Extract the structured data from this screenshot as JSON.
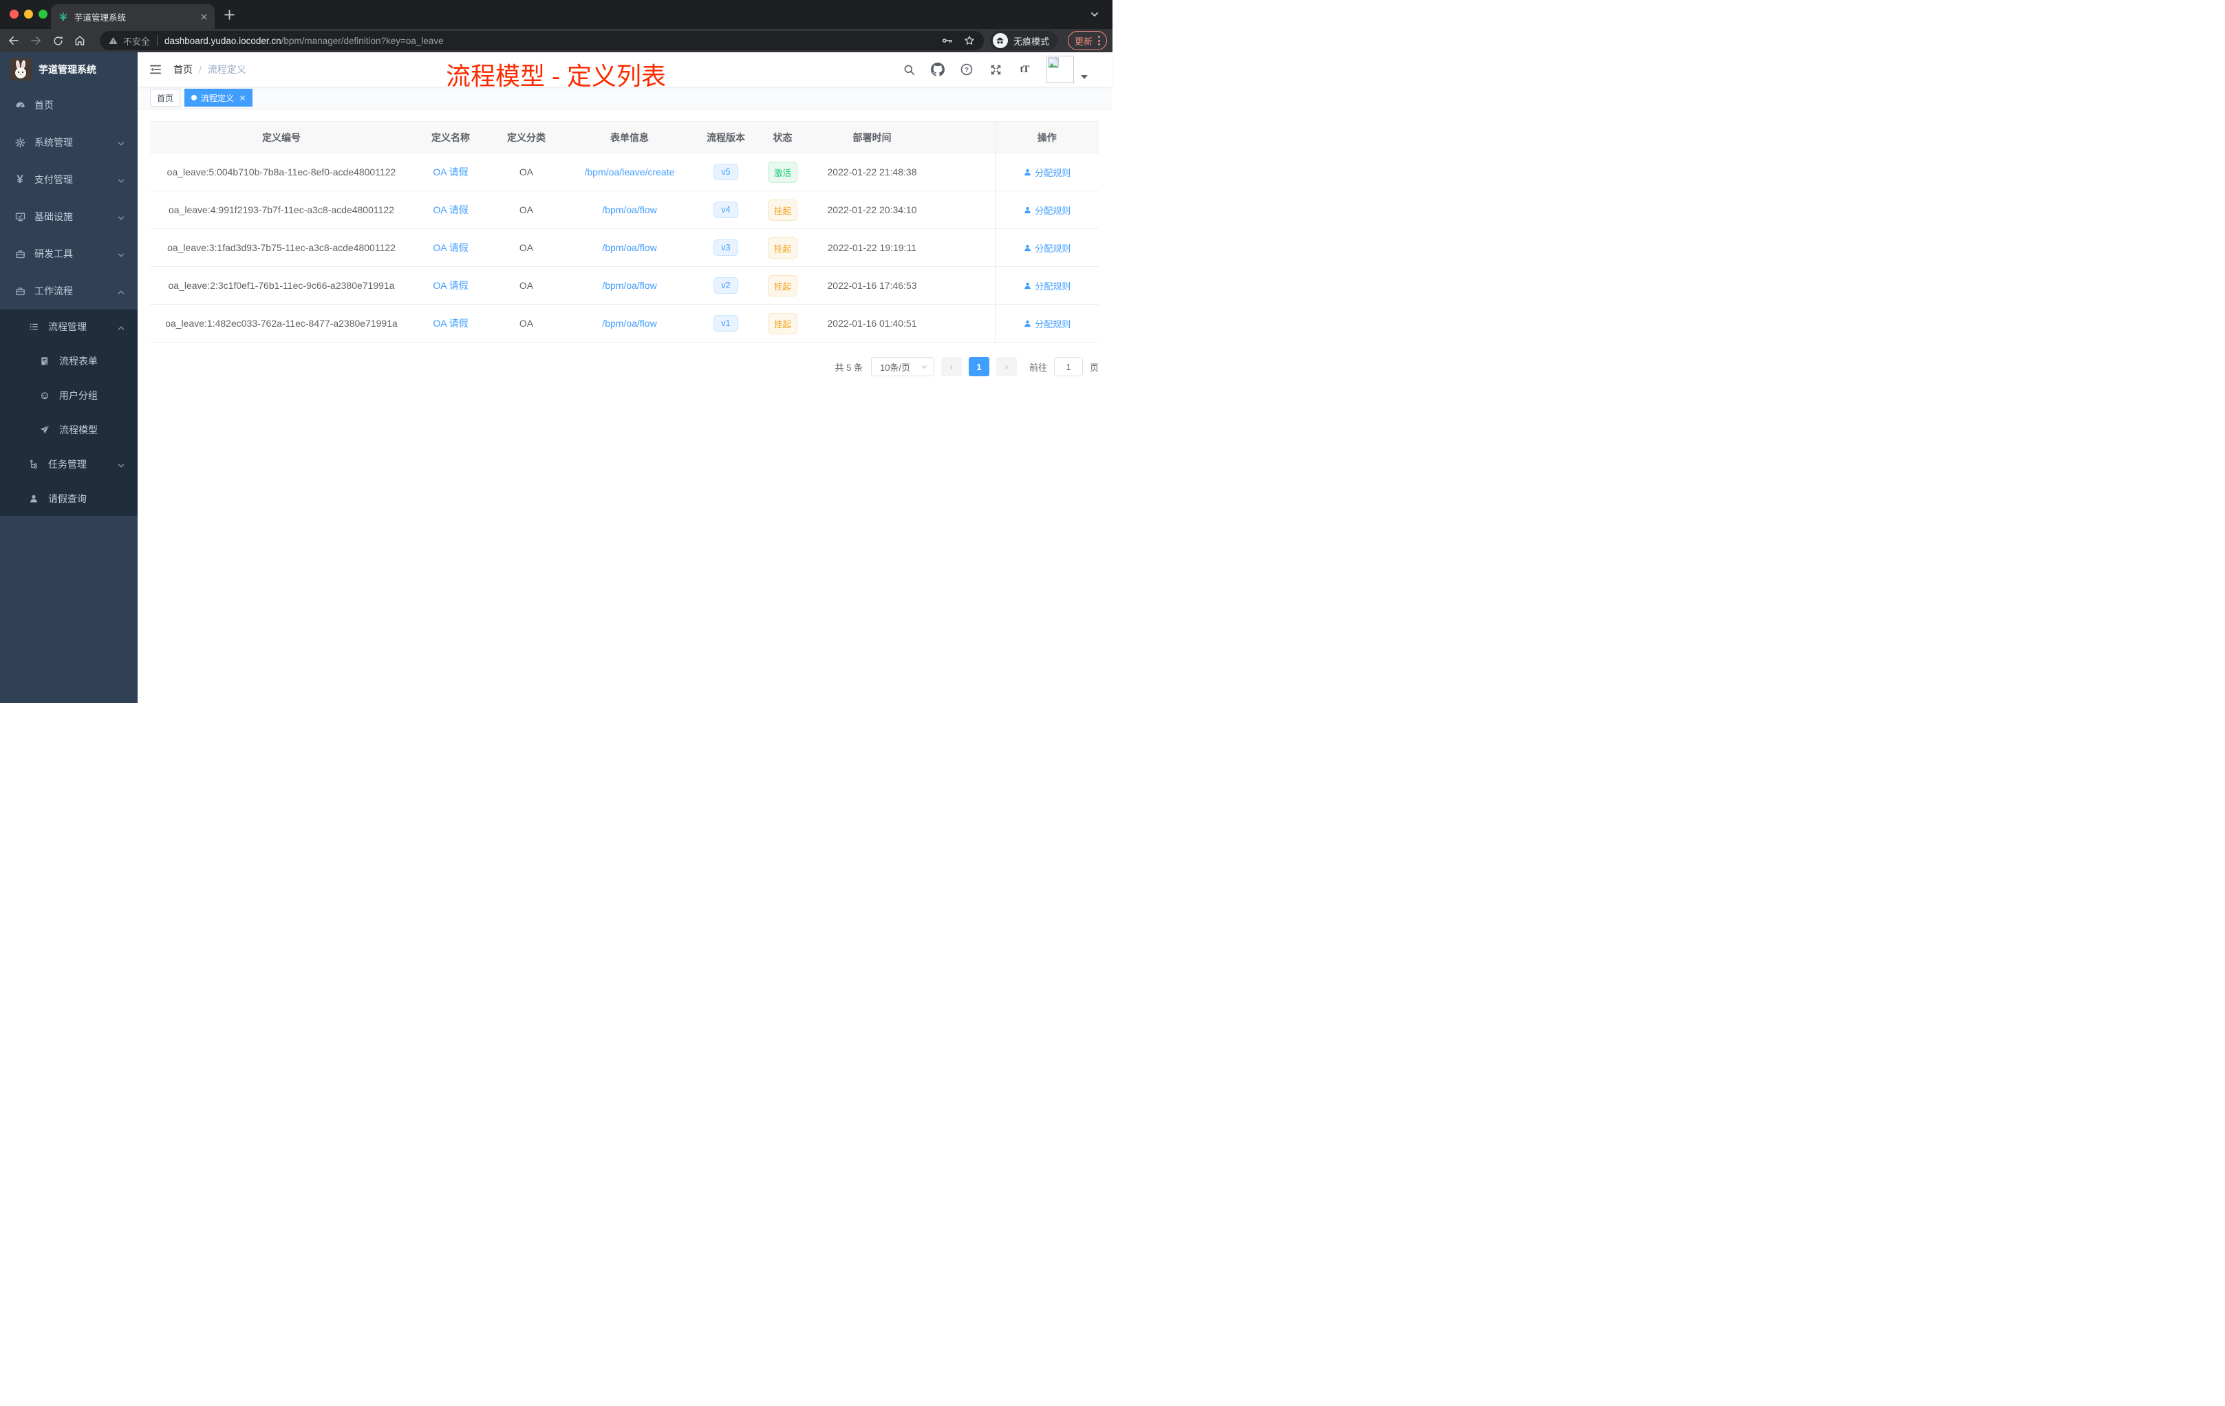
{
  "browser": {
    "tab": {
      "title": "芋道管理系统"
    },
    "url": {
      "security_text": "不安全",
      "host": "dashboard.yudao.iocoder.cn",
      "path": "/bpm/manager/definition?key=oa_leave"
    },
    "incognito_label": "无痕模式",
    "update_label": "更新"
  },
  "sidebar": {
    "title": "芋道管理系统",
    "items": [
      {
        "label": "首页",
        "icon": "dashboard-icon",
        "level": 1
      },
      {
        "label": "系统管理",
        "icon": "gear-icon",
        "level": 1,
        "state": "collapsed"
      },
      {
        "label": "支付管理",
        "icon": "yen-icon",
        "level": 1,
        "state": "collapsed"
      },
      {
        "label": "基础设施",
        "icon": "monitor-icon",
        "level": 1,
        "state": "collapsed"
      },
      {
        "label": "研发工具",
        "icon": "toolbox-icon",
        "level": 1,
        "state": "collapsed"
      },
      {
        "label": "工作流程",
        "icon": "briefcase-icon",
        "level": 1,
        "state": "expanded"
      },
      {
        "label": "流程管理",
        "icon": "list-icon",
        "level": 2,
        "state": "expanded"
      },
      {
        "label": "流程表单",
        "icon": "form-icon",
        "level": 3
      },
      {
        "label": "用户分组",
        "icon": "robot-icon",
        "level": 3
      },
      {
        "label": "流程模型",
        "icon": "paper-plane-icon",
        "level": 3
      },
      {
        "label": "任务管理",
        "icon": "branch-icon",
        "level": 2,
        "state": "collapsed"
      },
      {
        "label": "请假查询",
        "icon": "user-icon",
        "level": 2
      }
    ],
    "yen_glyph": "¥"
  },
  "navbar": {
    "breadcrumb": {
      "home": "首页",
      "separator": "/",
      "current": "流程定义"
    },
    "question_glyph": "?",
    "font_size_glyph": "tT"
  },
  "annotation": {
    "text": "流程模型 - 定义列表",
    "color": "#fb2b00"
  },
  "tags": {
    "home": "首页",
    "active": "流程定义"
  },
  "table": {
    "columns": [
      "定义编号",
      "定义名称",
      "定义分类",
      "表单信息",
      "流程版本",
      "状态",
      "部署时间",
      "操作"
    ],
    "action_label": "分配规则",
    "rows": [
      {
        "id": "oa_leave:5:004b710b-7b8a-11ec-8ef0-acde48001122",
        "name": "OA 请假",
        "category": "OA",
        "form": "/bpm/oa/leave/create",
        "version": "v5",
        "status": "激活",
        "status_type": "success",
        "time": "2022-01-22 21:48:38"
      },
      {
        "id": "oa_leave:4:991f2193-7b7f-11ec-a3c8-acde48001122",
        "name": "OA 请假",
        "category": "OA",
        "form": "/bpm/oa/flow",
        "version": "v4",
        "status": "挂起",
        "status_type": "warning",
        "time": "2022-01-22 20:34:10"
      },
      {
        "id": "oa_leave:3:1fad3d93-7b75-11ec-a3c8-acde48001122",
        "name": "OA 请假",
        "category": "OA",
        "form": "/bpm/oa/flow",
        "version": "v3",
        "status": "挂起",
        "status_type": "warning",
        "time": "2022-01-22 19:19:11"
      },
      {
        "id": "oa_leave:2:3c1f0ef1-76b1-11ec-9c66-a2380e71991a",
        "name": "OA 请假",
        "category": "OA",
        "form": "/bpm/oa/flow",
        "version": "v2",
        "status": "挂起",
        "status_type": "warning",
        "time": "2022-01-16 17:46:53"
      },
      {
        "id": "oa_leave:1:482ec033-762a-11ec-8477-a2380e71991a",
        "name": "OA 请假",
        "category": "OA",
        "form": "/bpm/oa/flow",
        "version": "v1",
        "status": "挂起",
        "status_type": "warning",
        "time": "2022-01-16 01:40:51"
      }
    ]
  },
  "pagination": {
    "total": "共 5 条",
    "page_size": "10条/页",
    "prev": "‹",
    "page": "1",
    "next": "›",
    "goto": "前往",
    "goto_value": "1",
    "unit": "页"
  },
  "colors": {
    "accent_blue": "#409eff",
    "annotation_red": "#fb2b00",
    "sidebar_bg": "#304156",
    "submenu_bg": "#1f2d3d",
    "status_active_green": "#15c96d",
    "status_suspend_orange": "#f1a41a",
    "tag_active_blue": "#409eff",
    "update_chip_orange": "#f28b82"
  }
}
